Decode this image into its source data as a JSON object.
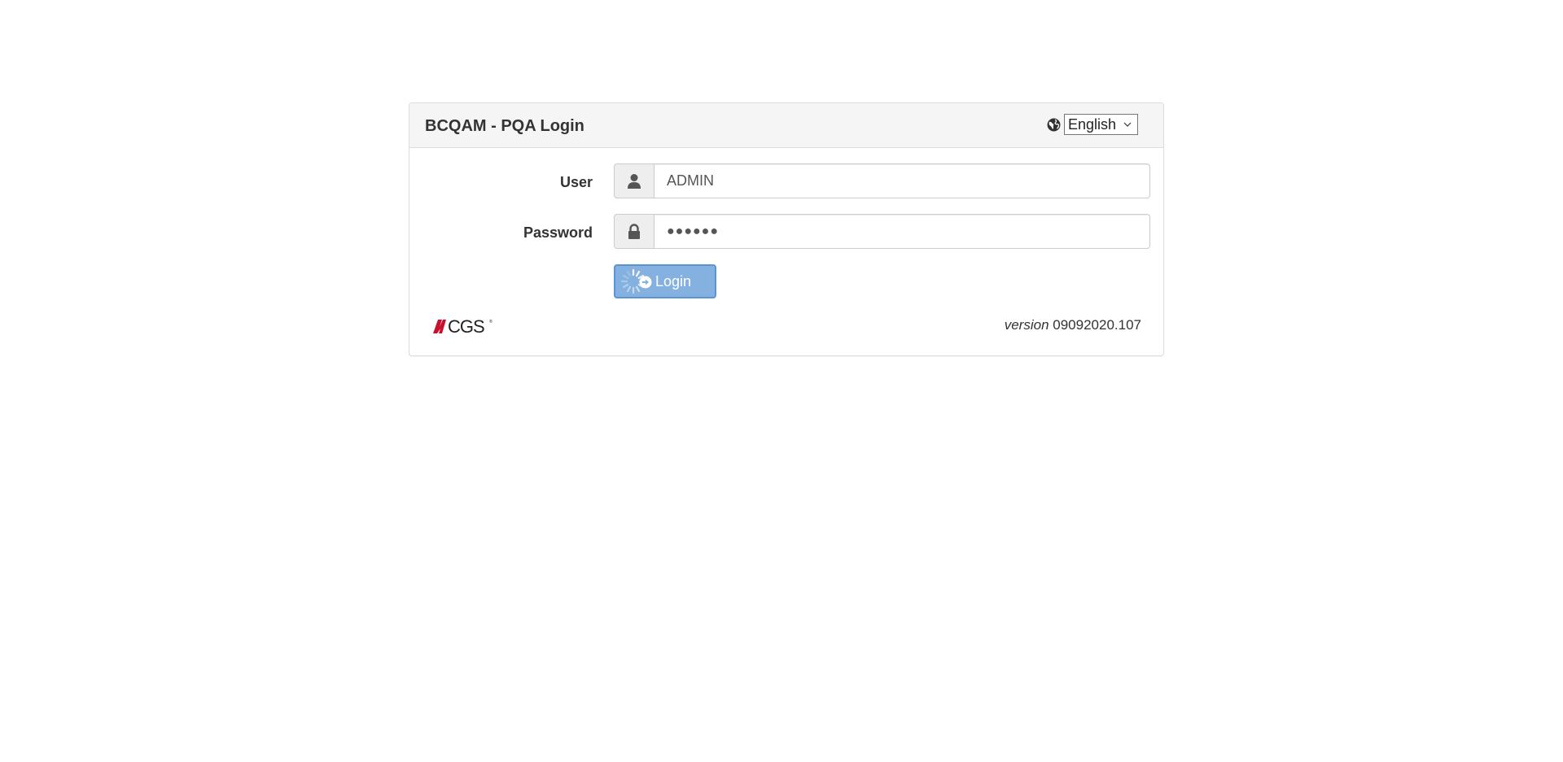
{
  "header": {
    "title": "BCQAM - PQA Login",
    "language_icon": "globe-icon",
    "language_selected": "English"
  },
  "form": {
    "user_label": "User",
    "user_icon": "user-icon",
    "user_value": "ADMIN",
    "password_label": "Password",
    "password_icon": "lock-icon",
    "password_value": "●●●●●●",
    "login_label": "Login",
    "login_state": "loading"
  },
  "footer": {
    "logo_text": "CGS",
    "version_prefix": "version",
    "version_number": "09092020.107"
  },
  "colors": {
    "heading_bg": "#f5f5f5",
    "button_bg": "#84b1df",
    "button_border": "#5b94d2",
    "logo_red": "#c8102e"
  }
}
